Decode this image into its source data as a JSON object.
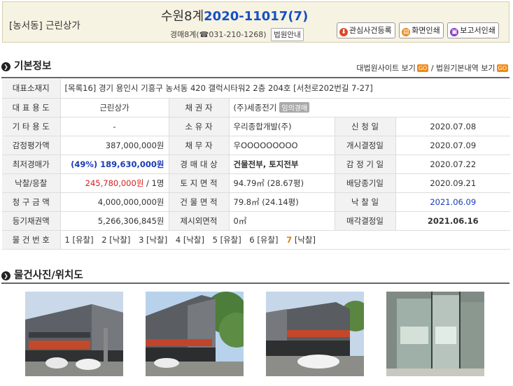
{
  "header": {
    "category": "[농서동] 근린상가",
    "court": "수원8계",
    "case_number": "2020-11017(7)",
    "dept": "경매8계",
    "phone": "031-210-1268",
    "court_info_label": "법원안내",
    "actions": [
      {
        "label": "관심사건등록",
        "icon": "download-icon",
        "color": "#e0472a"
      },
      {
        "label": "화면인쇄",
        "icon": "printer-icon",
        "color": "#e98a1a"
      },
      {
        "label": "보고서인쇄",
        "icon": "report-icon",
        "color": "#8c3cc2"
      }
    ]
  },
  "basic": {
    "title": "기본정보",
    "link_supreme": "대법원사이트 보기",
    "link_court": "법원기본내역 보기",
    "go": "GO"
  },
  "info": {
    "address_label": "대표소재지",
    "address_prefix": "[목록16]",
    "address": "경기 용인시 기흥구 농서동 420 갤럭시타워2 2층 204호 [서천로202번길 7-27]",
    "rows": [
      {
        "l1": "대 표 용 도",
        "v1": "근린상가",
        "l2": "채 권 자",
        "v2": "(주)세종전기",
        "chip": "임의경매",
        "l3": "",
        "v3": ""
      },
      {
        "l1": "기 타 용 도",
        "v1": "-",
        "l2": "소 유 자",
        "v2": "우리종합개발(주)",
        "l3": "신 청 일",
        "v3": "2020.07.08"
      },
      {
        "l1": "감정평가액",
        "v1": "387,000,000원",
        "l2": "채 무 자",
        "v2": "우OOOOOOOOO",
        "l3": "개시결정일",
        "v3": "2020.07.09"
      },
      {
        "l1": "최저경매가",
        "v1": "(49%) 189,630,000원",
        "l2": "경 매 대 상",
        "v2": "건물전부, 토지전부",
        "l3": "감 정 기 일",
        "v3": "2020.07.22"
      },
      {
        "l1": "낙찰/응찰",
        "v1a": "245,780,000원",
        "v1b": " / 1명",
        "l2": "토 지 면 적",
        "v2": "94.79㎡ (28.67평)",
        "l3": "배당종기일",
        "v3": "2020.09.21"
      },
      {
        "l1": "청 구 금 액",
        "v1": "4,000,000,000원",
        "l2": "건 물 면 적",
        "v2": "79.8㎡ (24.14평)",
        "l3": "낙 찰 일",
        "v3": "2021.06.09"
      },
      {
        "l1": "등기채권액",
        "v1": "5,266,306,845원",
        "l2": "제시외면적",
        "v2": "0㎡",
        "l3": "매각결정일",
        "v3": "2021.06.16"
      }
    ],
    "history_label": "물 건 번 호",
    "history": [
      {
        "num": "1",
        "status": "[유찰]"
      },
      {
        "num": "2",
        "status": "[낙찰]"
      },
      {
        "num": "3",
        "status": "[낙찰]"
      },
      {
        "num": "4",
        "status": "[낙찰]"
      },
      {
        "num": "5",
        "status": "[유찰]"
      },
      {
        "num": "6",
        "status": "[유찰]"
      },
      {
        "num": "7",
        "status": "[낙찰]"
      }
    ]
  },
  "photos": {
    "title": "물건사진/위치도",
    "items": [
      "building-photo-front",
      "building-photo-side",
      "building-photo-corner",
      "interior-photo"
    ]
  }
}
